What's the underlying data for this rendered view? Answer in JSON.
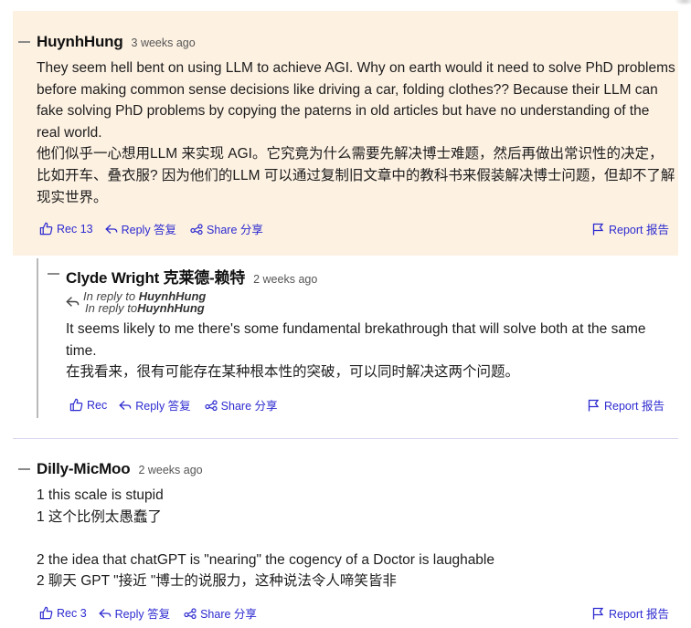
{
  "comments": [
    {
      "author": "HuynhHung",
      "time": "3 weeks ago",
      "body": [
        "They seem hell bent on using LLM to achieve AGI. Why on earth would it need to solve PhD problems before making common sense decisions like driving a car, folding clothes?? Because their LLM can fake solving PhD problems by copying the paterns in old articles but have no understanding of the real world.",
        "他们似乎一心想用LLM 来实现 AGI。它究竟为什么需要先解决博士难题，然后再做出常识性的决定，比如开车、叠衣服? 因为他们的LLM 可以通过复制旧文章中的教科书来假装解决博士问题，但却不了解现实世界。"
      ],
      "rec_label": "Rec 13",
      "reply_label": "Reply 答复",
      "share_label": "Share 分享",
      "report_label": "Report 报告"
    },
    {
      "author": "Clyde Wright 克莱德-赖特",
      "time": "2 weeks ago",
      "in_reply_line1_prefix": "In reply to ",
      "in_reply_line1_name": "HuynhHung",
      "in_reply_line2_prefix": "In reply to",
      "in_reply_line2_name": "HuynhHung",
      "body": [
        "It seems likely to me there's some fundamental brekathrough that will solve both at the same time.",
        "在我看来，很有可能存在某种根本性的突破，可以同时解决这两个问题。"
      ],
      "rec_label": "Rec",
      "reply_label": "Reply 答复",
      "share_label": "Share 分享",
      "report_label": "Report 报告"
    },
    {
      "author": "Dilly-MicMoo",
      "time": "2 weeks ago",
      "body": [
        "1 this scale is stupid",
        "1 这个比例太愚蠢了",
        "",
        "2 the idea that chatGPT is \"nearing\" the cogency of a Doctor is laughable",
        "2 聊天 GPT \"接近 \"博士的说服力，这种说法令人啼笑皆非"
      ],
      "rec_label": "Rec 3",
      "reply_label": "Reply 答复",
      "share_label": "Share 分享",
      "report_label": "Report 报告"
    }
  ],
  "colors": {
    "highlight_bg": "#fdf1e2",
    "link": "#2d2bd0",
    "divider": "#d4d3ec"
  }
}
